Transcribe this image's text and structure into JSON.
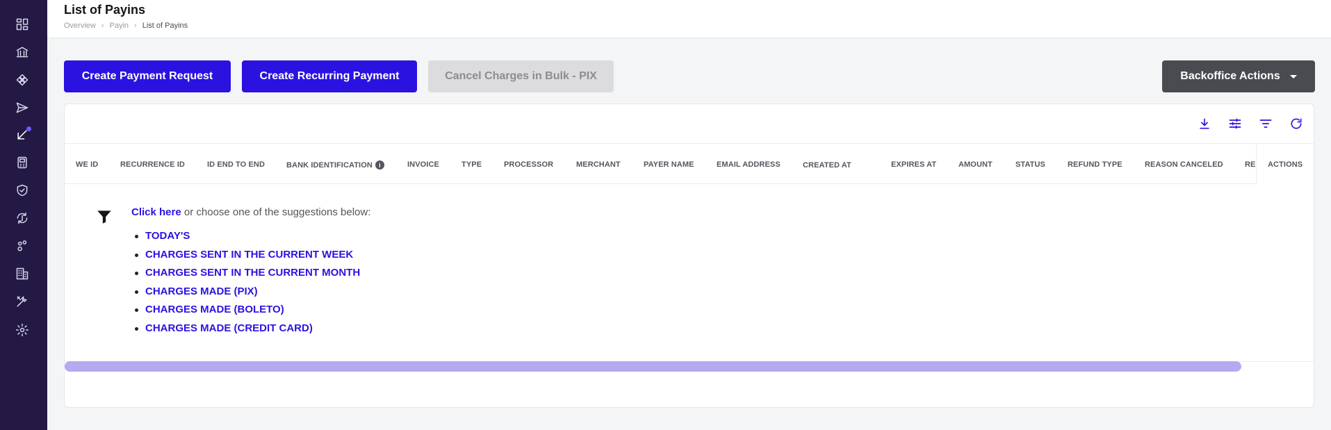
{
  "header": {
    "title": "List of Payins",
    "breadcrumb": [
      "Overview",
      "Payin",
      "List of Payins"
    ]
  },
  "sidebar": {
    "items": [
      {
        "icon": "dashboard-icon"
      },
      {
        "icon": "bank-icon"
      },
      {
        "icon": "pix-icon"
      },
      {
        "icon": "send-icon"
      },
      {
        "icon": "payin-arrow-icon",
        "active": true
      },
      {
        "icon": "pos-terminal-icon"
      },
      {
        "icon": "shield-check-icon"
      },
      {
        "icon": "recurring-icon"
      },
      {
        "icon": "nodes-icon"
      },
      {
        "icon": "building-icon"
      },
      {
        "icon": "tools-icon"
      },
      {
        "icon": "gear-icon"
      }
    ]
  },
  "actions": {
    "create_payment_request": "Create Payment Request",
    "create_recurring_payment": "Create Recurring Payment",
    "cancel_bulk": "Cancel Charges in Bulk - PIX",
    "backoffice": "Backoffice Actions"
  },
  "toolbar": {
    "icons": [
      "download-icon",
      "columns-settings-icon",
      "filter-lines-icon",
      "refresh-icon"
    ]
  },
  "table": {
    "columns": [
      "WE ID",
      "RECURRENCE ID",
      "ID END TO END",
      "BANK IDENTIFICATION",
      "INVOICE",
      "TYPE",
      "PROCESSOR",
      "MERCHANT",
      "PAYER NAME",
      "EMAIL ADDRESS",
      "CREATED AT",
      "EXPIRES AT",
      "AMOUNT",
      "STATUS",
      "REFUND TYPE",
      "REASON CANCELED",
      "REI"
    ],
    "actions_column": "ACTIONS"
  },
  "empty_state": {
    "link_text": "Click here",
    "text": " or choose one of the suggestions below:",
    "suggestions": [
      "TODAY'S",
      "CHARGES SENT IN THE CURRENT WEEK",
      "CHARGES SENT IN THE CURRENT MONTH",
      "CHARGES MADE (PIX)",
      "CHARGES MADE (BOLETO)",
      "CHARGES MADE (CREDIT CARD)"
    ]
  },
  "colors": {
    "primary": "#2b12e0",
    "sidebar": "#231944",
    "scrollbar": "#b7a9f0"
  }
}
